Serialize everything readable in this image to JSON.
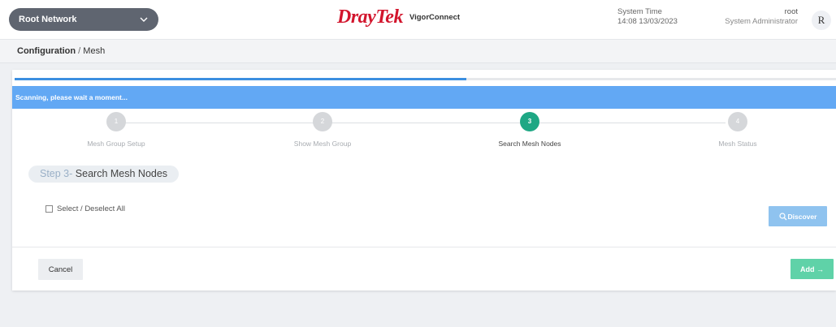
{
  "header": {
    "network_select": "Root Network",
    "brand_dray": "Dray",
    "brand_tek": "Tek",
    "product": "VigorConnect",
    "system_time_label": "System Time",
    "system_time_value": "14:08 13/03/2023",
    "user_name": "root",
    "user_role": "System Administrator",
    "avatar_letter": "R"
  },
  "breadcrumb": {
    "section": "Configuration",
    "separator": "/",
    "page": "Mesh"
  },
  "wizard": {
    "progress_fraction": 0.55,
    "banner_text": "Scanning, please wait a moment...",
    "active_step": 3,
    "steps": [
      {
        "number": "1",
        "label": "Mesh Group Setup"
      },
      {
        "number": "2",
        "label": "Show Mesh Group"
      },
      {
        "number": "3",
        "label": "Search Mesh Nodes"
      },
      {
        "number": "4",
        "label": "Mesh Status"
      }
    ],
    "step_title_prefix": "Step 3-",
    "step_title": "Search Mesh Nodes",
    "select_all_label": "Select / Deselect All",
    "discover_label": "Discover",
    "cancel_label": "Cancel",
    "add_label": "Add →"
  },
  "colors": {
    "brand_red": "#d2152d",
    "banner_blue": "#62a8f4",
    "progress_blue": "#3c8fe0",
    "active_green": "#1ea784",
    "add_green": "#5fd2a8",
    "discover_blue": "#8fc3ef"
  },
  "icons": {
    "network_dropdown": "chevron-down-icon",
    "discover": "search-icon"
  }
}
